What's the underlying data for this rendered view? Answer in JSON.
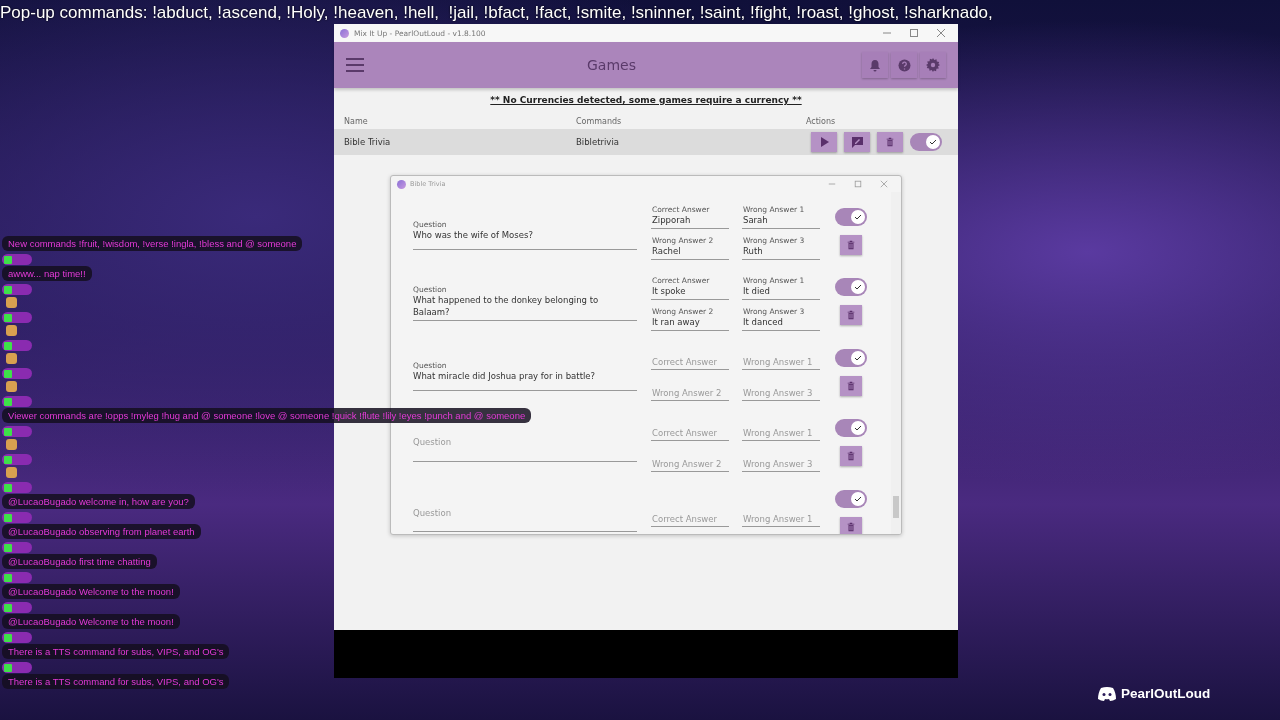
{
  "banner": {
    "text": "Pop-up commands: !abduct, !ascend, !Holy, !heaven, !hell,  !jail, !bfact, !fact, !smite, !sninner, !saint, !fight, !roast, !ghost, !sharknado,"
  },
  "pinned_message": {
    "text": "New commands !fruit, !wisdom, !verse !ingla, !bless and @ someone"
  },
  "chat": [
    {
      "kind": "text",
      "text": "awww... nap time!!"
    },
    {
      "kind": "emote"
    },
    {
      "kind": "emote"
    },
    {
      "kind": "emote"
    },
    {
      "kind": "emote"
    },
    {
      "kind": "text",
      "text": "Viewer commands are !opps !myleg !hug and @ someone !love @ someone !quick !flute !lily !eyes !punch and @ someone"
    },
    {
      "kind": "emote"
    },
    {
      "kind": "emote"
    },
    {
      "kind": "text",
      "text": "@LucaoBugado welcome in, how are you?"
    },
    {
      "kind": "text",
      "text": "@LucaoBugado observing from planet earth"
    },
    {
      "kind": "text",
      "text": "@LucaoBugado first time chatting"
    },
    {
      "kind": "text",
      "text": "@LucaoBugado Welcome to the moon!"
    },
    {
      "kind": "text",
      "text": "@LucaoBugado Welcome to the moon!"
    },
    {
      "kind": "text",
      "text": "There is a TTS command for subs, VIPS, and OG's"
    },
    {
      "kind": "text",
      "text": "There is a TTS command for subs, VIPS, and OG's"
    }
  ],
  "window": {
    "title": "Mix It Up - PearlOutLoud - v1.8.100",
    "header": "Games",
    "notice": "** No Currencies detected, some games require a currency **",
    "table": {
      "columns": [
        "Name",
        "Commands",
        "Actions"
      ],
      "rows": [
        {
          "name": "Bible Trivia",
          "commands": "Bibletrivia",
          "enabled": true
        }
      ]
    }
  },
  "dialog": {
    "title": "Bible Trivia",
    "rows": [
      {
        "enabled": true,
        "question": {
          "label": "Question",
          "value": "Who was the wife of Moses?"
        },
        "answers": [
          {
            "label": "Correct Answer",
            "value": "Zipporah"
          },
          {
            "label": "Wrong Answer 1",
            "value": "Sarah"
          },
          {
            "label": "Wrong Answer 2",
            "value": "Rachel"
          },
          {
            "label": "Wrong Answer 3",
            "value": "Ruth"
          }
        ]
      },
      {
        "enabled": true,
        "question": {
          "label": "Question",
          "value": "What happened to the donkey belonging to Balaam?"
        },
        "answers": [
          {
            "label": "Correct Answer",
            "value": "It spoke"
          },
          {
            "label": "Wrong Answer 1",
            "value": "It died"
          },
          {
            "label": "Wrong Answer 2",
            "value": "It ran away"
          },
          {
            "label": "Wrong Answer 3",
            "value": "It danced"
          }
        ]
      },
      {
        "enabled": true,
        "question": {
          "label": "Question",
          "value": "What miracle did Joshua pray for in battle?"
        },
        "answers": [
          {
            "placeholder": "Correct Answer"
          },
          {
            "placeholder": "Wrong Answer 1"
          },
          {
            "placeholder": "Wrong Answer 2"
          },
          {
            "placeholder": "Wrong Answer 3"
          }
        ]
      },
      {
        "enabled": true,
        "question": {
          "placeholder": "Question"
        },
        "answers": [
          {
            "placeholder": "Correct Answer"
          },
          {
            "placeholder": "Wrong Answer 1"
          },
          {
            "placeholder": "Wrong Answer 2"
          },
          {
            "placeholder": "Wrong Answer 3"
          }
        ]
      },
      {
        "enabled": true,
        "question": {
          "placeholder": "Question"
        },
        "answers": [
          {
            "placeholder": "Correct Answer"
          },
          {
            "placeholder": "Wrong Answer 1"
          }
        ]
      }
    ]
  },
  "stream_tag": {
    "name": "PearlOutLoud"
  }
}
